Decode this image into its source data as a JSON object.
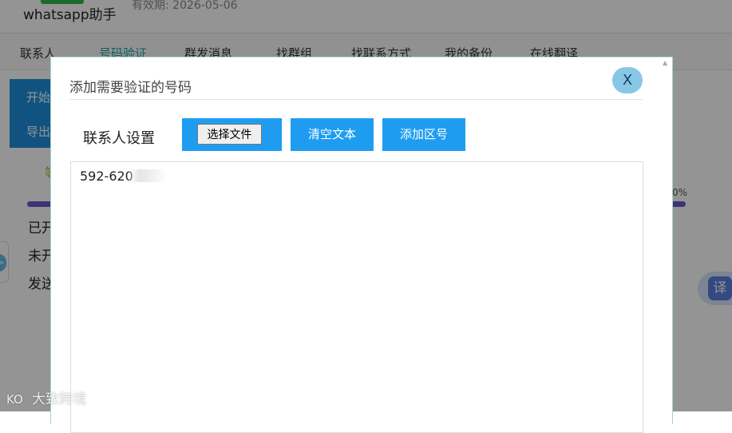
{
  "header": {
    "app_name": "whatsapp助手",
    "validity": "有效期: 2026-05-06"
  },
  "nav": {
    "items": [
      {
        "label": "联系人"
      },
      {
        "label": "号码验证",
        "active": true
      },
      {
        "label": "群发消息"
      },
      {
        "label": "找群组"
      },
      {
        "label": "找联系方式"
      },
      {
        "label": "我的备份"
      },
      {
        "label": "在线翻译"
      }
    ]
  },
  "background": {
    "start_button": "开始",
    "export_button": "导出",
    "status_glyph": "等",
    "progress_percent": "0%",
    "line1": "已开",
    "line2": "未开",
    "line3": "发送"
  },
  "translate_button": "译",
  "modal": {
    "title": "添加需要验证的号码",
    "close_label": "X",
    "settings_label": "联系人设置",
    "choose_file_label": "选择文件",
    "clear_text_label": "清空文本",
    "add_area_code_label": "添加区号",
    "textarea_value": "592-620"
  },
  "watermark": {
    "text": "大致跨境"
  },
  "colors": {
    "primary_blue": "#1e9df0",
    "nav_active": "#1aa0a0",
    "progress": "#6a5acd",
    "close_button": "#87c7e5"
  }
}
